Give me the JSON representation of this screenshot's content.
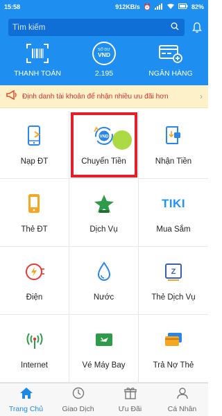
{
  "status_bar": {
    "time": "15:58",
    "network": "912KB/s",
    "battery": "82%"
  },
  "search": {
    "placeholder": "Tìm kiếm"
  },
  "quick_actions": [
    {
      "label": "THANH TOÁN",
      "icon": "barcode-scan-icon"
    },
    {
      "label": "2.195",
      "icon": "balance-vnd-icon",
      "badge_top": "SỐ DƯ",
      "badge_main": "VND"
    },
    {
      "label": "NGÂN HÀNG",
      "icon": "bank-card-add-icon"
    }
  ],
  "banner": {
    "text": "Định danh tài khoản để nhận nhiều ưu đãi hơn",
    "icon": "megaphone-icon"
  },
  "services": [
    {
      "label": "Nạp ĐT",
      "icon": "phone-topup-icon"
    },
    {
      "label": "Chuyển Tiền",
      "icon": "transfer-money-icon",
      "badge": "VND"
    },
    {
      "label": "Nhận Tiền",
      "icon": "receive-money-icon"
    },
    {
      "label": "Thẻ ĐT",
      "icon": "phone-card-icon"
    },
    {
      "label": "Dịch Vụ",
      "icon": "star-service-icon"
    },
    {
      "label": "Mua Sắm",
      "icon": "tiki-icon",
      "badge": "TIKI"
    },
    {
      "label": "Điện",
      "icon": "electric-plug-icon"
    },
    {
      "label": "Nước",
      "icon": "water-drop-icon"
    },
    {
      "label": "Thẻ Dịch Vụ",
      "icon": "service-card-icon",
      "badge": "Z"
    },
    {
      "label": "Internet",
      "icon": "wifi-antenna-icon"
    },
    {
      "label": "Vé Máy Bay",
      "icon": "plane-ticket-icon"
    },
    {
      "label": "Trả Nợ Thẻ",
      "icon": "credit-card-icon"
    }
  ],
  "tabs": [
    {
      "label": "Trang Chủ",
      "icon": "home-icon",
      "active": true
    },
    {
      "label": "Giao Dịch",
      "icon": "clock-icon"
    },
    {
      "label": "Ưu Đãi",
      "icon": "gift-icon"
    },
    {
      "label": "Cá Nhân",
      "icon": "user-icon"
    }
  ],
  "colors": {
    "primary": "#1e8ff0",
    "highlight": "#e3202a",
    "banner_bg": "#fdf1c9",
    "banner_text": "#d62f2f",
    "active_tab": "#1e88e5"
  }
}
